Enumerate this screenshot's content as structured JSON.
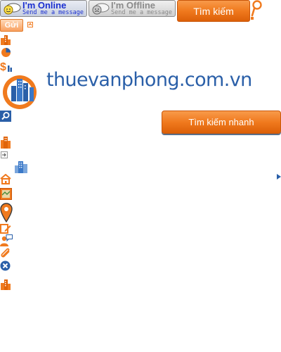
{
  "status_badges": {
    "online": {
      "title": "I'm Online",
      "subtitle": "Send me a message",
      "color": "#1a2fd0"
    },
    "offline": {
      "title": "I'm Offline",
      "subtitle": "Send me a message",
      "color": "#8a8a8a"
    }
  },
  "header": {
    "search_button_label": "Tìm kiếm",
    "send_button_label": "Gửi"
  },
  "logo": {
    "text": "thuevanphong.com.vn",
    "text_color": "#2a5fa8"
  },
  "quick_search": {
    "button_label": "Tìm kiếm nhanh"
  },
  "icons": [
    "buildings-icon",
    "pie-chart-icon",
    "price-chart-icon",
    "search-icon",
    "building-icon",
    "enter-arrow-icon",
    "office-building-icon",
    "home-icon",
    "map-icon",
    "location-pin-icon",
    "edit-icon",
    "contact-person-icon",
    "paperclip-icon",
    "close-circle-icon",
    "buildings-bottom-icon",
    "arrow-right-icon"
  ],
  "colors": {
    "accent_orange": "#f07a1e",
    "brand_blue": "#2a5fa8",
    "icon_orange": "#f07a1e"
  }
}
